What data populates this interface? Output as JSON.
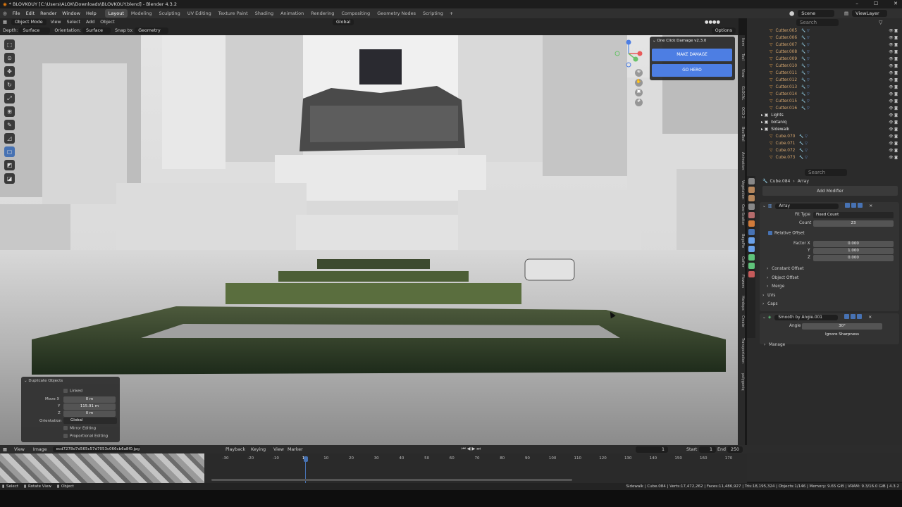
{
  "window": {
    "title": "* BLOVKOUY [C:\\Users\\ALOK\\Downloads\\BLOVKOUY.blend] - Blender 4.3.2",
    "controls": [
      "–",
      "☐",
      "✕"
    ]
  },
  "menu": {
    "items": [
      "File",
      "Edit",
      "Render",
      "Window",
      "Help"
    ],
    "workspaces": [
      "Layout",
      "Modeling",
      "Sculpting",
      "UV Editing",
      "Texture Paint",
      "Shading",
      "Animation",
      "Rendering",
      "Compositing",
      "Geometry Nodes",
      "Scripting"
    ],
    "active_workspace": "Layout",
    "scene": "Scene",
    "view_layer": "ViewLayer"
  },
  "viewport_header": {
    "mode": "Object Mode",
    "view": "View",
    "select": "Select",
    "add": "Add",
    "object": "Object",
    "transform": "Global",
    "options": "Options"
  },
  "snap_bar": {
    "depth_label": "Depth:",
    "depth": "Surface",
    "orientation_label": "Orientation:",
    "orientation": "Surface",
    "snap_label": "Snap to:",
    "snap": "Geometry"
  },
  "ocd": {
    "title": "One Click Damage v2.3.0",
    "make": "MAKE DAMAGE",
    "go": "GO HERO"
  },
  "n_tabs": [
    "Item",
    "Tool",
    "View",
    "GLOCAL",
    "OCD 2",
    "BoolTool",
    "Animation",
    "Vegetation",
    "Geo-Scatter",
    "BagaPie",
    "Gaffer",
    "Flowers",
    "Hardops",
    "Create",
    "Transportation",
    "polygoniq"
  ],
  "dup_panel": {
    "title": "Duplicate Objects",
    "linked": "Linked",
    "move_x_label": "Move X",
    "move_x": "0 m",
    "y_label": "Y",
    "y": "115.91 m",
    "z_label": "Z",
    "z": "0 m",
    "orient_label": "Orientation",
    "orient": "Global",
    "mirror": "Mirror Editing",
    "prop": "Proportional Editing"
  },
  "outliner": {
    "search": "Search",
    "items": [
      {
        "name": "Cutter.005",
        "indent": 2,
        "type": "mesh"
      },
      {
        "name": "Cutter.006",
        "indent": 2,
        "type": "mesh"
      },
      {
        "name": "Cutter.007",
        "indent": 2,
        "type": "mesh"
      },
      {
        "name": "Cutter.008",
        "indent": 2,
        "type": "mesh"
      },
      {
        "name": "Cutter.009",
        "indent": 2,
        "type": "mesh"
      },
      {
        "name": "Cutter.010",
        "indent": 2,
        "type": "mesh"
      },
      {
        "name": "Cutter.011",
        "indent": 2,
        "type": "mesh"
      },
      {
        "name": "Cutter.012",
        "indent": 2,
        "type": "mesh"
      },
      {
        "name": "Cutter.013",
        "indent": 2,
        "type": "mesh"
      },
      {
        "name": "Cutter.014",
        "indent": 2,
        "type": "mesh"
      },
      {
        "name": "Cutter.015",
        "indent": 2,
        "type": "mesh"
      },
      {
        "name": "Cutter.016",
        "indent": 2,
        "type": "mesh"
      },
      {
        "name": "Lights",
        "indent": 1,
        "type": "coll"
      },
      {
        "name": "botaniq",
        "indent": 1,
        "type": "coll"
      },
      {
        "name": "Sidewalk",
        "indent": 1,
        "type": "coll"
      },
      {
        "name": "Cube.070",
        "indent": 2,
        "type": "obj"
      },
      {
        "name": "Cube.071",
        "indent": 2,
        "type": "obj"
      },
      {
        "name": "Cube.072",
        "indent": 2,
        "type": "obj"
      },
      {
        "name": "Cube.073",
        "indent": 2,
        "type": "obj"
      }
    ]
  },
  "properties": {
    "search": "Search",
    "object": "Cube.084",
    "modifier_crumb": "Array",
    "add_modifier": "Add Modifier",
    "array": {
      "name": "Array",
      "fit_type_label": "Fit Type",
      "fit_type": "Fixed Count",
      "count_label": "Count",
      "count": "23",
      "relative_offset": "Relative Offset",
      "factor_x_label": "Factor X",
      "factor_x": "0.000",
      "y_label": "Y",
      "y": "1.000",
      "z_label": "Z",
      "z": "0.000",
      "sub": [
        "Constant Offset",
        "Object Offset",
        "Merge",
        "UVs",
        "Caps"
      ]
    },
    "smooth": {
      "name": "Smooth by Angle.001",
      "angle_label": "Angle",
      "angle": "30°",
      "ignore": "Ignore Sharpness",
      "manage": "Manage"
    }
  },
  "timeline": {
    "view": "View",
    "image": "Image",
    "file": "ecd7278d7d565c57d7053c066cb6a8f0.jpg",
    "playback": "Playback",
    "keying": "Keying",
    "view2": "View",
    "marker": "Marker",
    "current": "1",
    "start_label": "Start",
    "start": "1",
    "end_label": "End",
    "end": "250",
    "ticks": [
      "-30",
      "-20",
      "-10",
      "1",
      "10",
      "20",
      "30",
      "40",
      "50",
      "60",
      "70",
      "80",
      "90",
      "100",
      "110",
      "120",
      "130",
      "140",
      "150",
      "160",
      "170"
    ]
  },
  "status": {
    "select": "Select",
    "rotate": "Rotate View",
    "object": "Object",
    "stats": "Sidewalk | Cube.084 | Verts:17,472,262 | Faces:11,486,927 | Tris:18,195,324 | Objects:1/146 | Memory: 9.65 GiB | VRAM: 9.3/16.0 GiB | 4.3.2"
  },
  "colors": {
    "accent": "#4772b3",
    "button_blue": "#4d7ee3",
    "mesh_orange": "#e89f4a",
    "modifier_blue": "#6aa0e8",
    "green": "#5fc27a"
  }
}
